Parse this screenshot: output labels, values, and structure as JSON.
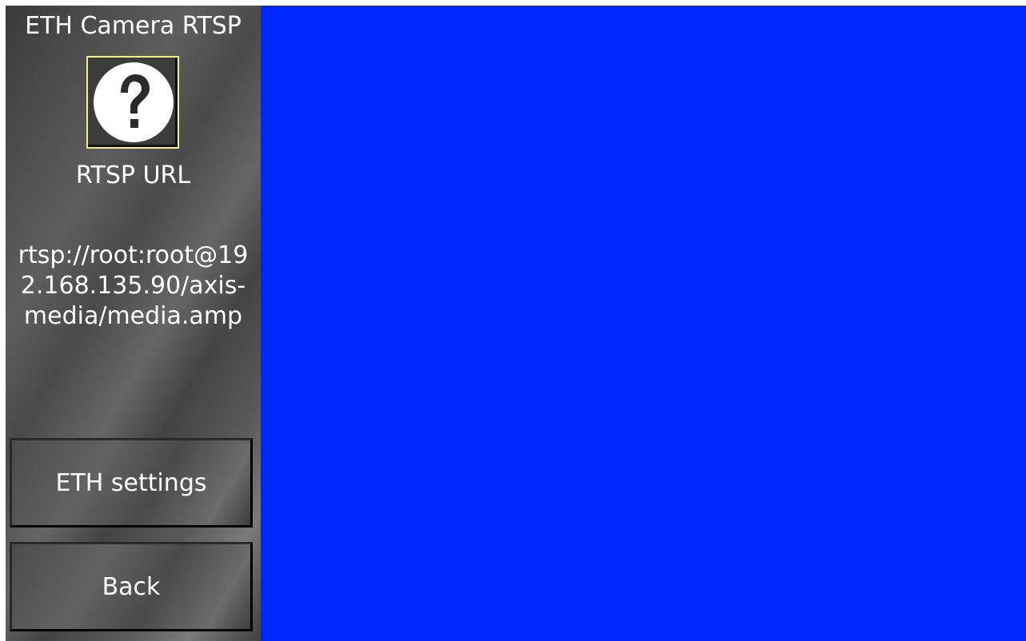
{
  "sidebar": {
    "title": "ETH Camera RTSP",
    "url_caption": "RTSP URL",
    "url_value": "rtsp://root:root@192.168.135.90/axis-media/media.amp",
    "icon": "question-icon",
    "buttons": {
      "eth_settings": "ETH settings",
      "back": "Back"
    }
  },
  "colors": {
    "video_background": "#0026ff",
    "icon_highlight": "#f4ef8a"
  }
}
